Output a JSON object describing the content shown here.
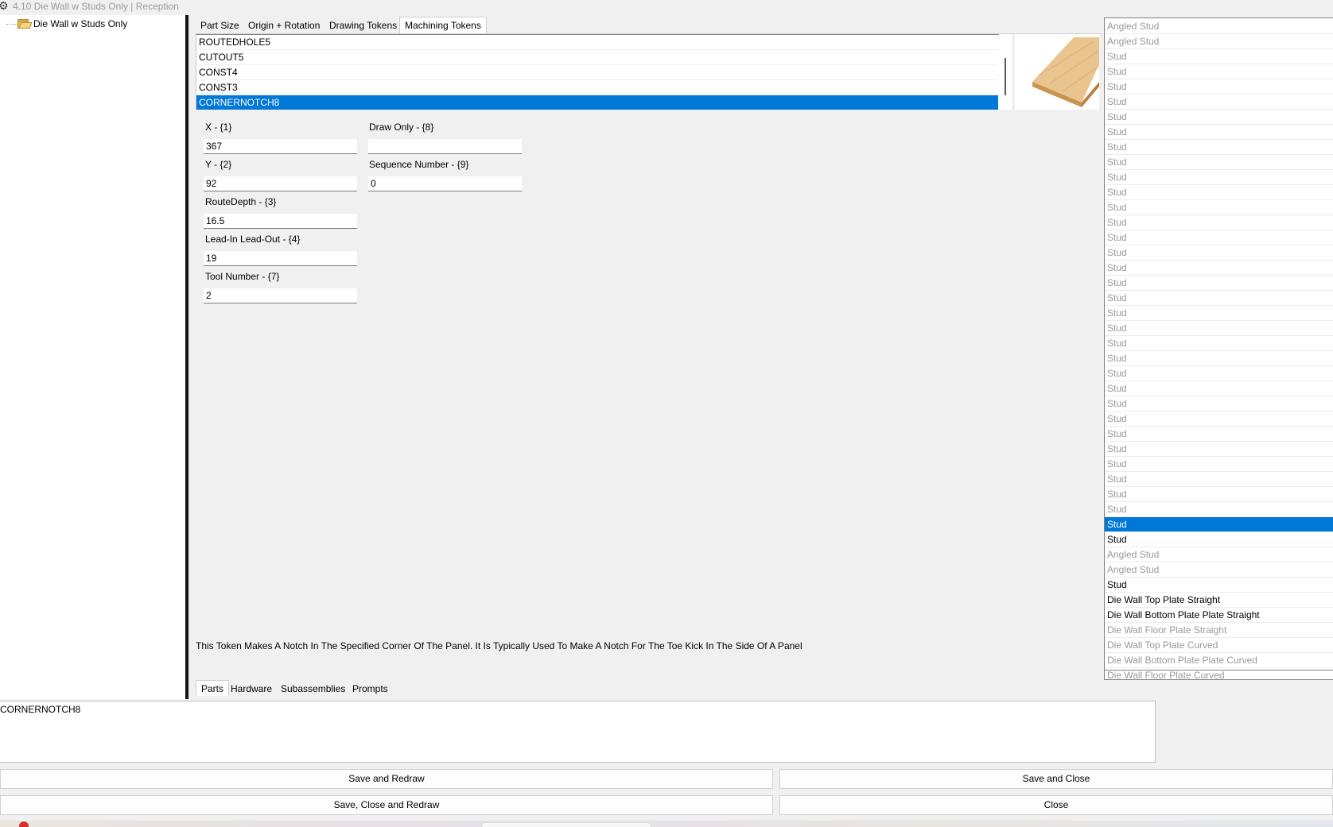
{
  "window": {
    "title": "4.10 Die Wall w Studs Only | Reception"
  },
  "tree": {
    "root_label": "Die Wall w Studs Only"
  },
  "top_tabs": [
    {
      "label": "Part  Size"
    },
    {
      "label": "Origin + Rotation"
    },
    {
      "label": "Drawing Tokens"
    },
    {
      "label": "Machining Tokens"
    }
  ],
  "tokens": {
    "items": [
      "ROUTEDHOLE5",
      "CUTOUT5",
      "CONST4",
      "CONST3",
      "CORNERNOTCH8"
    ],
    "selected": "CORNERNOTCH8"
  },
  "fields": {
    "x": {
      "label": "X - {1}",
      "value": "367"
    },
    "y": {
      "label": "Y - {2}",
      "value": "92"
    },
    "route_depth": {
      "label": "RouteDepth - {3}",
      "value": "16.5"
    },
    "lead_in": {
      "label": "Lead-In Lead-Out - {4}",
      "value": "19"
    },
    "tool_number": {
      "label": "Tool Number - {7}",
      "value": "2"
    },
    "draw_only": {
      "label": "Draw Only - {8}",
      "value": ""
    },
    "sequence_number": {
      "label": "Sequence Number - {9}",
      "value": "0"
    }
  },
  "description": "This Token Makes A Notch In The Specified Corner Of The Panel. It Is Typically Used To Make A Notch For The Toe Kick In The Side Of A Panel",
  "bottom_tabs": [
    {
      "label": "Parts"
    },
    {
      "label": "Hardware"
    },
    {
      "label": "Subassemblies"
    },
    {
      "label": "Prompts"
    }
  ],
  "parts": [
    {
      "label": "Angled Stud",
      "state": "grey"
    },
    {
      "label": "Angled Stud",
      "state": "grey"
    },
    {
      "label": "Stud",
      "state": "grey"
    },
    {
      "label": "Stud",
      "state": "grey"
    },
    {
      "label": "Stud",
      "state": "grey"
    },
    {
      "label": "Stud",
      "state": "grey"
    },
    {
      "label": "Stud",
      "state": "grey"
    },
    {
      "label": "Stud",
      "state": "grey"
    },
    {
      "label": "Stud",
      "state": "grey"
    },
    {
      "label": "Stud",
      "state": "grey"
    },
    {
      "label": "Stud",
      "state": "grey"
    },
    {
      "label": "Stud",
      "state": "grey"
    },
    {
      "label": "Stud",
      "state": "grey"
    },
    {
      "label": "Stud",
      "state": "grey"
    },
    {
      "label": "Stud",
      "state": "grey"
    },
    {
      "label": "Stud",
      "state": "grey"
    },
    {
      "label": "Stud",
      "state": "grey"
    },
    {
      "label": "Stud",
      "state": "grey"
    },
    {
      "label": "Stud",
      "state": "grey"
    },
    {
      "label": "Stud",
      "state": "grey"
    },
    {
      "label": "Stud",
      "state": "grey"
    },
    {
      "label": "Stud",
      "state": "grey"
    },
    {
      "label": "Stud",
      "state": "grey"
    },
    {
      "label": "Stud",
      "state": "grey"
    },
    {
      "label": "Stud",
      "state": "grey"
    },
    {
      "label": "Stud",
      "state": "grey"
    },
    {
      "label": "Stud",
      "state": "grey"
    },
    {
      "label": "Stud",
      "state": "grey"
    },
    {
      "label": "Stud",
      "state": "grey"
    },
    {
      "label": "Stud",
      "state": "grey"
    },
    {
      "label": "Stud",
      "state": "grey"
    },
    {
      "label": "Stud",
      "state": "grey"
    },
    {
      "label": "Stud",
      "state": "grey"
    },
    {
      "label": "Stud",
      "state": "selected"
    },
    {
      "label": "Stud",
      "state": "dark"
    },
    {
      "label": "Angled Stud",
      "state": "grey"
    },
    {
      "label": "Angled Stud",
      "state": "grey"
    },
    {
      "label": "Stud",
      "state": "dark"
    },
    {
      "label": "Die Wall Top Plate Straight",
      "state": "dark"
    },
    {
      "label": "Die Wall Bottom Plate Plate Straight",
      "state": "dark"
    },
    {
      "label": "Die Wall Floor Plate Straight",
      "state": "grey"
    },
    {
      "label": "Die Wall Top Plate Curved",
      "state": "grey"
    },
    {
      "label": "Die Wall Bottom Plate Plate Curved",
      "state": "grey"
    },
    {
      "label": "Die Wall Floor Plate Curved",
      "state": "grey"
    }
  ],
  "note": "CORNERNOTCH8",
  "buttons": {
    "save_redraw": "Save and Redraw",
    "save_close": "Save and Close",
    "save_close_redraw": "Save, Close and Redraw",
    "close": "Close"
  },
  "colors": {
    "selection": "#0078d7",
    "disabled_text": "#9a9a9a",
    "window_bg": "#f0f0f0"
  },
  "icons": {
    "window_icon": "gear-icon",
    "tree_icon": "folder-open-icon",
    "preview": "wood-board-icon"
  }
}
